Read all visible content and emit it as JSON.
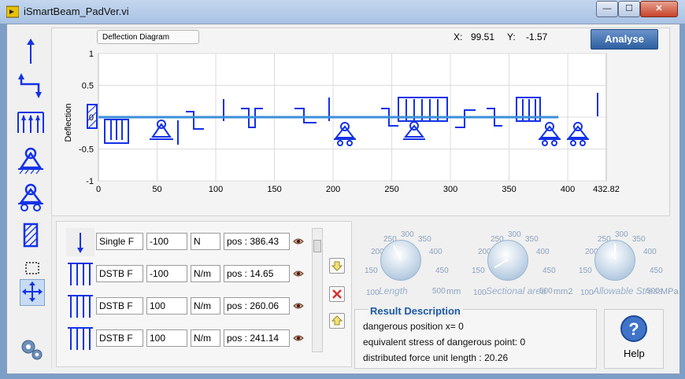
{
  "window": {
    "title": "iSmartBeam_PadVer.vi",
    "minimize": "—",
    "maximize": "☐",
    "close": "✕"
  },
  "chart": {
    "dropdown_label": "Deflection Diagram",
    "x_label": "X:",
    "x_value": "99.51",
    "y_label": "Y:",
    "y_value": "-1.57",
    "analyse_label": "Analyse"
  },
  "chart_data": {
    "type": "line",
    "ylabel": "Deflection",
    "xlim": [
      0,
      432.82
    ],
    "ylim": [
      -1,
      1
    ],
    "x_ticks": [
      "0",
      "50",
      "100",
      "150",
      "200",
      "250",
      "300",
      "350",
      "400",
      "432.82"
    ],
    "y_ticks": [
      "1",
      "0.5",
      "0",
      "-0.5",
      "-1"
    ],
    "series": [
      {
        "x": [
          0,
          392
        ],
        "y": [
          0,
          0
        ],
        "color": "#3b8fd9"
      }
    ],
    "grid": true
  },
  "loads": [
    {
      "type": "Single F",
      "value": "-100",
      "unit": "N",
      "pos": "pos : 386.43"
    },
    {
      "type": "DSTB F",
      "value": "-100",
      "unit": "N/m",
      "pos": "pos : 14.65"
    },
    {
      "type": "DSTB F",
      "value": "100",
      "unit": "N/m",
      "pos": "pos : 260.06"
    },
    {
      "type": "DSTB F",
      "value": "100",
      "unit": "N/m",
      "pos": "pos : 241.14"
    }
  ],
  "dials": [
    {
      "caption": "Length",
      "unit": "mm",
      "ticks": [
        "100",
        "150",
        "200",
        "250",
        "300",
        "350",
        "400",
        "450",
        "500"
      ],
      "level_pct": 40
    },
    {
      "caption": "Sectional area",
      "unit": "mm2",
      "ticks": [
        "100",
        "150",
        "200",
        "250",
        "300",
        "350",
        "400",
        "450",
        "500"
      ],
      "level_pct": 5
    },
    {
      "caption": "Allowable Stress",
      "unit": "MPa",
      "ticks": [
        "100",
        "150",
        "200",
        "250",
        "300",
        "350",
        "400",
        "450",
        "500"
      ],
      "level_pct": 50
    }
  ],
  "result": {
    "title": "Result Description",
    "line1": "dangerous position x= 0",
    "line2": "equivalent stress of dangerous point: 0",
    "line3": "distributed force unit length :   20.26"
  },
  "help": {
    "label": "Help"
  },
  "colors": {
    "accent": "#1432e6",
    "curve": "#3b8fd9",
    "titlebar": "#b3c9e8"
  }
}
